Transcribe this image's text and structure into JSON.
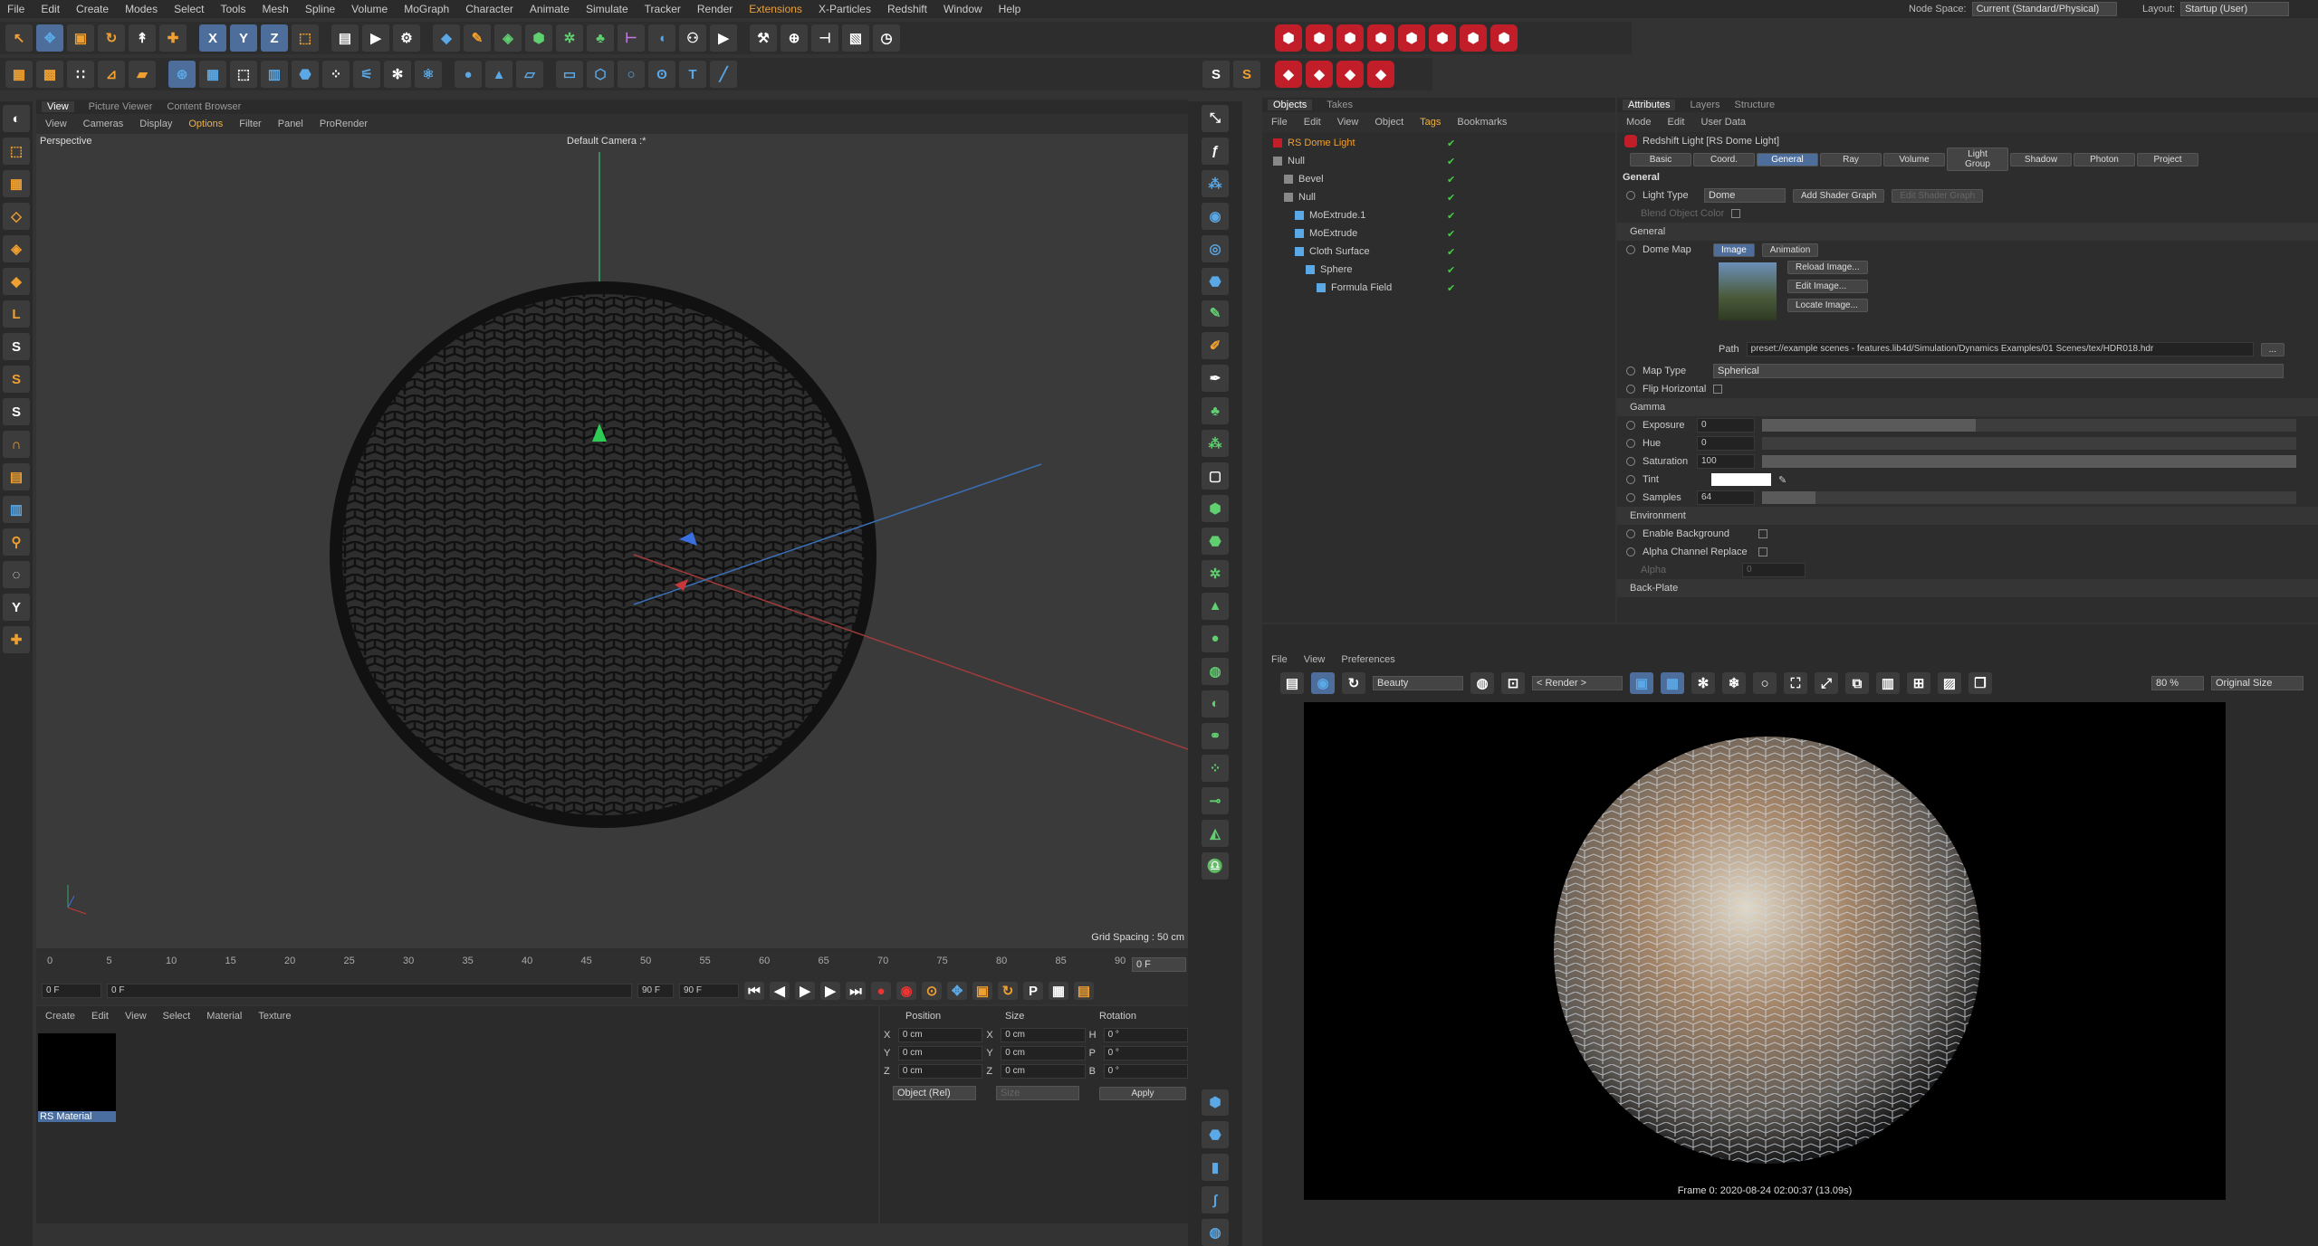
{
  "menu": [
    "File",
    "Edit",
    "Create",
    "Modes",
    "Select",
    "Tools",
    "Mesh",
    "Spline",
    "Volume",
    "MoGraph",
    "Character",
    "Animate",
    "Simulate",
    "Tracker",
    "Render",
    "Extensions",
    "X-Particles",
    "Redshift",
    "Window",
    "Help"
  ],
  "node_space": {
    "label": "Node Space:",
    "value": "Current (Standard/Physical)"
  },
  "layout": {
    "label": "Layout:",
    "value": "Startup (User)"
  },
  "viewport": {
    "tabs": [
      "View",
      "Picture Viewer",
      "Content Browser"
    ],
    "menu": [
      "View",
      "Cameras",
      "Display",
      "Options",
      "Filter",
      "Panel",
      "ProRender"
    ],
    "name": "Perspective",
    "camera": "Default Camera :*",
    "grid": "Grid Spacing : 50 cm"
  },
  "timeline": {
    "ticks": [
      "0",
      "5",
      "10",
      "15",
      "20",
      "25",
      "30",
      "35",
      "40",
      "45",
      "50",
      "55",
      "60",
      "65",
      "70",
      "75",
      "80",
      "85",
      "90"
    ],
    "frame_end": "0 F",
    "cur": "0 F",
    "f2": "0 F",
    "end1": "90 F",
    "end2": "90 F"
  },
  "material": {
    "menu": [
      "Create",
      "Edit",
      "View",
      "Select",
      "Material",
      "Texture"
    ],
    "item": "RS Material"
  },
  "coords": {
    "headers": [
      "Position",
      "Size",
      "Rotation"
    ],
    "rows": [
      {
        "a": "X",
        "p": "0 cm",
        "b": "X",
        "s": "0 cm",
        "c": "H",
        "r": "0 °"
      },
      {
        "a": "Y",
        "p": "0 cm",
        "b": "Y",
        "s": "0 cm",
        "c": "P",
        "r": "0 °"
      },
      {
        "a": "Z",
        "p": "0 cm",
        "b": "Z",
        "s": "0 cm",
        "c": "B",
        "r": "0 °"
      }
    ],
    "mode": "Object (Rel)",
    "size": "Size",
    "apply": "Apply"
  },
  "objects": {
    "tabs": [
      "Objects",
      "Takes"
    ],
    "menu": [
      "File",
      "Edit",
      "View",
      "Object",
      "Tags",
      "Bookmarks"
    ],
    "items": [
      "RS Dome Light",
      "Null",
      "Bevel",
      "Null",
      "MoExtrude.1",
      "MoExtrude",
      "Cloth Surface",
      "Sphere",
      "Formula Field"
    ]
  },
  "attributes": {
    "tabs": [
      "Attributes",
      "Layers",
      "Structure"
    ],
    "menu": [
      "Mode",
      "Edit",
      "User Data"
    ],
    "title": "Redshift Light [RS Dome Light]",
    "subtabs": [
      "Basic",
      "Coord.",
      "General",
      "Ray",
      "Volume",
      "Light Group",
      "Shadow",
      "Photon",
      "Project"
    ],
    "section": "General",
    "light_type_label": "Light Type",
    "light_type": "Dome",
    "add_shader": "Add Shader Graph",
    "edit_shader": "Edit Shader Graph",
    "blend": "Blend Object Color",
    "group_general": "General",
    "dome_map": "Dome Map",
    "image_tab": "Image",
    "anim_tab": "Animation",
    "reload": "Reload Image...",
    "edit": "Edit Image...",
    "locate": "Locate Image...",
    "path_label": "Path",
    "path": "preset://example scenes - features.lib4d/Simulation/Dynamics Examples/01 Scenes/tex/HDR018.hdr",
    "map_type_label": "Map Type",
    "map_type": "Spherical",
    "flip": "Flip Horizontal",
    "gamma": "Gamma",
    "params": [
      {
        "name": "Exposure",
        "val": "0"
      },
      {
        "name": "Hue",
        "val": "0"
      },
      {
        "name": "Saturation",
        "val": "100"
      },
      {
        "name": "Tint",
        "val": ""
      },
      {
        "name": "Samples",
        "val": "64"
      }
    ],
    "env": "Environment",
    "enable_bg": "Enable Background",
    "alpha_replace": "Alpha Channel Replace",
    "alpha": "Alpha",
    "alpha_val": "0",
    "backplate": "Back-Plate"
  },
  "render": {
    "menu": [
      "File",
      "View",
      "Preferences"
    ],
    "aov": "Beauty",
    "render": "< Render >",
    "zoom": "80 %",
    "size": "Original Size",
    "status": "Frame  0:  2020-08-24  02:00:37  (13.09s)"
  }
}
